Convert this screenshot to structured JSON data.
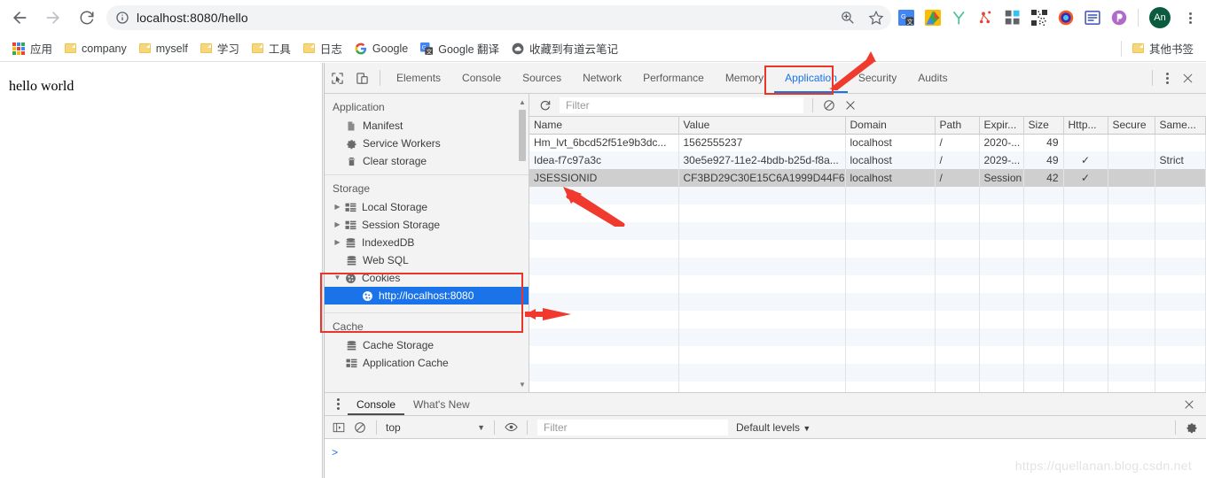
{
  "browser": {
    "url": "localhost:8080/hello",
    "nav": {
      "back": "back-arrow",
      "forward": "forward-arrow",
      "reload": "reload"
    },
    "profile_initials": "An",
    "bookmarks": [
      {
        "label": "应用",
        "icon": "apps-grid"
      },
      {
        "label": "company",
        "icon": "folder"
      },
      {
        "label": "myself",
        "icon": "folder"
      },
      {
        "label": "学习",
        "icon": "folder"
      },
      {
        "label": "工具",
        "icon": "folder"
      },
      {
        "label": "日志",
        "icon": "folder"
      },
      {
        "label": "Google",
        "icon": "google-g"
      },
      {
        "label": "Google 翻译",
        "icon": "google-translate"
      },
      {
        "label": "收藏到有道云笔记",
        "icon": "youdao"
      }
    ],
    "other_bookmarks": {
      "label": "其他书签",
      "icon": "folder"
    }
  },
  "page": {
    "body_text": "hello world"
  },
  "devtools": {
    "tabs": [
      {
        "label": "Elements",
        "active": false
      },
      {
        "label": "Console",
        "active": false
      },
      {
        "label": "Sources",
        "active": false
      },
      {
        "label": "Network",
        "active": false
      },
      {
        "label": "Performance",
        "active": false
      },
      {
        "label": "Memory",
        "active": false
      },
      {
        "label": "Application",
        "active": true
      },
      {
        "label": "Security",
        "active": false
      },
      {
        "label": "Audits",
        "active": false
      }
    ],
    "sidebar": {
      "sections": [
        {
          "title": "Application",
          "items": [
            {
              "label": "Manifest",
              "icon": "document-icon",
              "twisty": "",
              "indent": 1,
              "selected": false
            },
            {
              "label": "Service Workers",
              "icon": "gear-icon",
              "twisty": "",
              "indent": 1,
              "selected": false
            },
            {
              "label": "Clear storage",
              "icon": "trash-icon",
              "twisty": "",
              "indent": 1,
              "selected": false
            }
          ]
        },
        {
          "title": "Storage",
          "items": [
            {
              "label": "Local Storage",
              "icon": "table-icon",
              "twisty": "▶",
              "indent": 1,
              "selected": false
            },
            {
              "label": "Session Storage",
              "icon": "table-icon",
              "twisty": "▶",
              "indent": 1,
              "selected": false
            },
            {
              "label": "IndexedDB",
              "icon": "database-icon",
              "twisty": "▶",
              "indent": 1,
              "selected": false
            },
            {
              "label": "Web SQL",
              "icon": "database-icon",
              "twisty": "",
              "indent": 1,
              "selected": false
            },
            {
              "label": "Cookies",
              "icon": "cookie-icon",
              "twisty": "▼",
              "indent": 1,
              "selected": false
            },
            {
              "label": "http://localhost:8080",
              "icon": "cookie-icon",
              "twisty": "",
              "indent": 2,
              "selected": true
            }
          ]
        },
        {
          "title": "Cache",
          "items": [
            {
              "label": "Cache Storage",
              "icon": "database-icon",
              "twisty": "",
              "indent": 1,
              "selected": false
            },
            {
              "label": "Application Cache",
              "icon": "table-icon",
              "twisty": "",
              "indent": 1,
              "selected": false
            }
          ]
        }
      ]
    },
    "cookie_toolbar": {
      "refresh_icon": "refresh-icon",
      "filter_placeholder": "Filter",
      "clear_icon": "clear-all-icon",
      "delete_icon": "delete-icon"
    },
    "cookie_table": {
      "columns": [
        "Name",
        "Value",
        "Domain",
        "Path",
        "Expir...",
        "Size",
        "Http...",
        "Secure",
        "Same..."
      ],
      "rows": [
        {
          "name": "Hm_lvt_6bcd52f51e9b3dc...",
          "value": "1562555237",
          "domain": "localhost",
          "path": "/",
          "expires": "2020-...",
          "size": "49",
          "http_only": "",
          "secure": "",
          "same_site": "",
          "selected": false
        },
        {
          "name": "Idea-f7c97a3c",
          "value": "30e5e927-11e2-4bdb-b25d-f8a...",
          "domain": "localhost",
          "path": "/",
          "expires": "2029-...",
          "size": "49",
          "http_only": "✓",
          "secure": "",
          "same_site": "Strict",
          "selected": false
        },
        {
          "name": "JSESSIONID",
          "value": "CF3BD29C30E15C6A1999D44F6...",
          "domain": "localhost",
          "path": "/",
          "expires": "Session",
          "size": "42",
          "http_only": "✓",
          "secure": "",
          "same_site": "",
          "selected": true
        }
      ]
    },
    "drawer": {
      "tabs": [
        {
          "label": "Console",
          "active": true
        },
        {
          "label": "What's New",
          "active": false
        }
      ],
      "close_icon": "close-icon",
      "console_toolbar": {
        "sidebar_icon": "show-console-sidebar-icon",
        "clear_icon": "clear-console-icon",
        "context": "top",
        "eye_icon": "live-expression-icon",
        "filter_placeholder": "Filter",
        "levels": "Default levels",
        "settings_icon": "gear-icon"
      },
      "prompt": ">"
    }
  },
  "annotations": {
    "watermark": "https://quellanan.blog.csdn.net",
    "highlight_color": "#e8372a",
    "boxes": [
      "application-tab",
      "cookies-tree-region"
    ],
    "arrows": [
      "arrow-to-application-tab",
      "arrow-to-cookies-origin",
      "arrow-to-jsessionid-row"
    ]
  }
}
